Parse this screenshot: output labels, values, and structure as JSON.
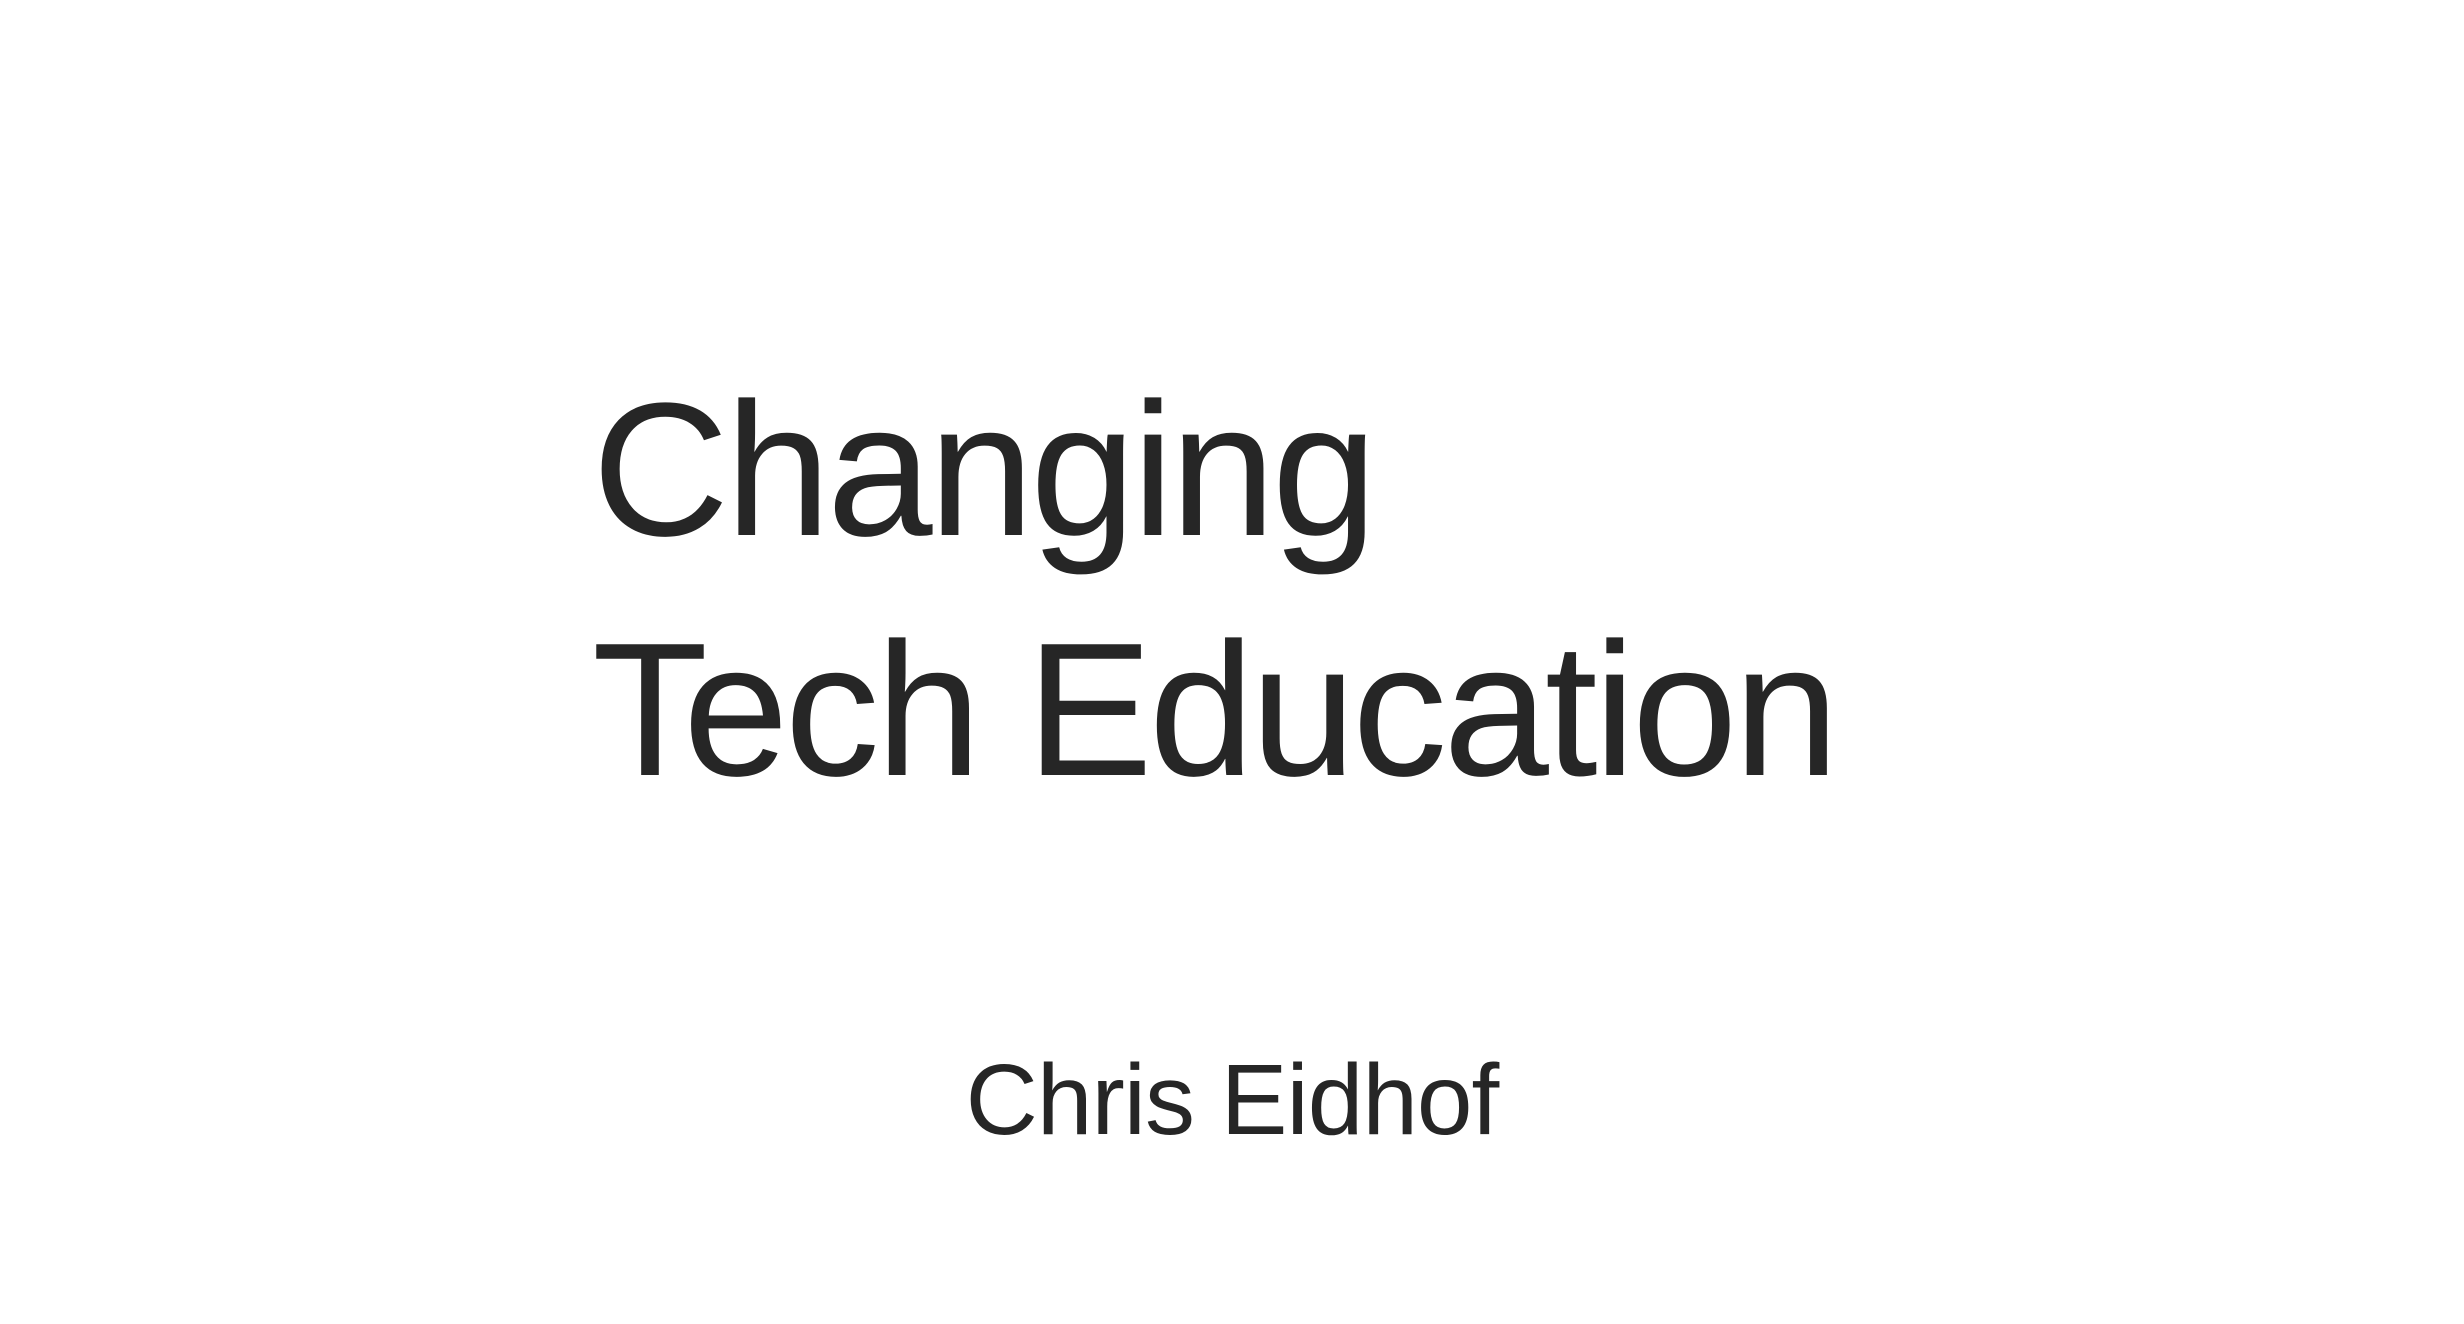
{
  "slide": {
    "title_line_1": "Changing",
    "title_line_2": "Tech Education",
    "author": "Chris Eidhof"
  },
  "colors": {
    "background": "#ffffff",
    "text": "#262626"
  }
}
